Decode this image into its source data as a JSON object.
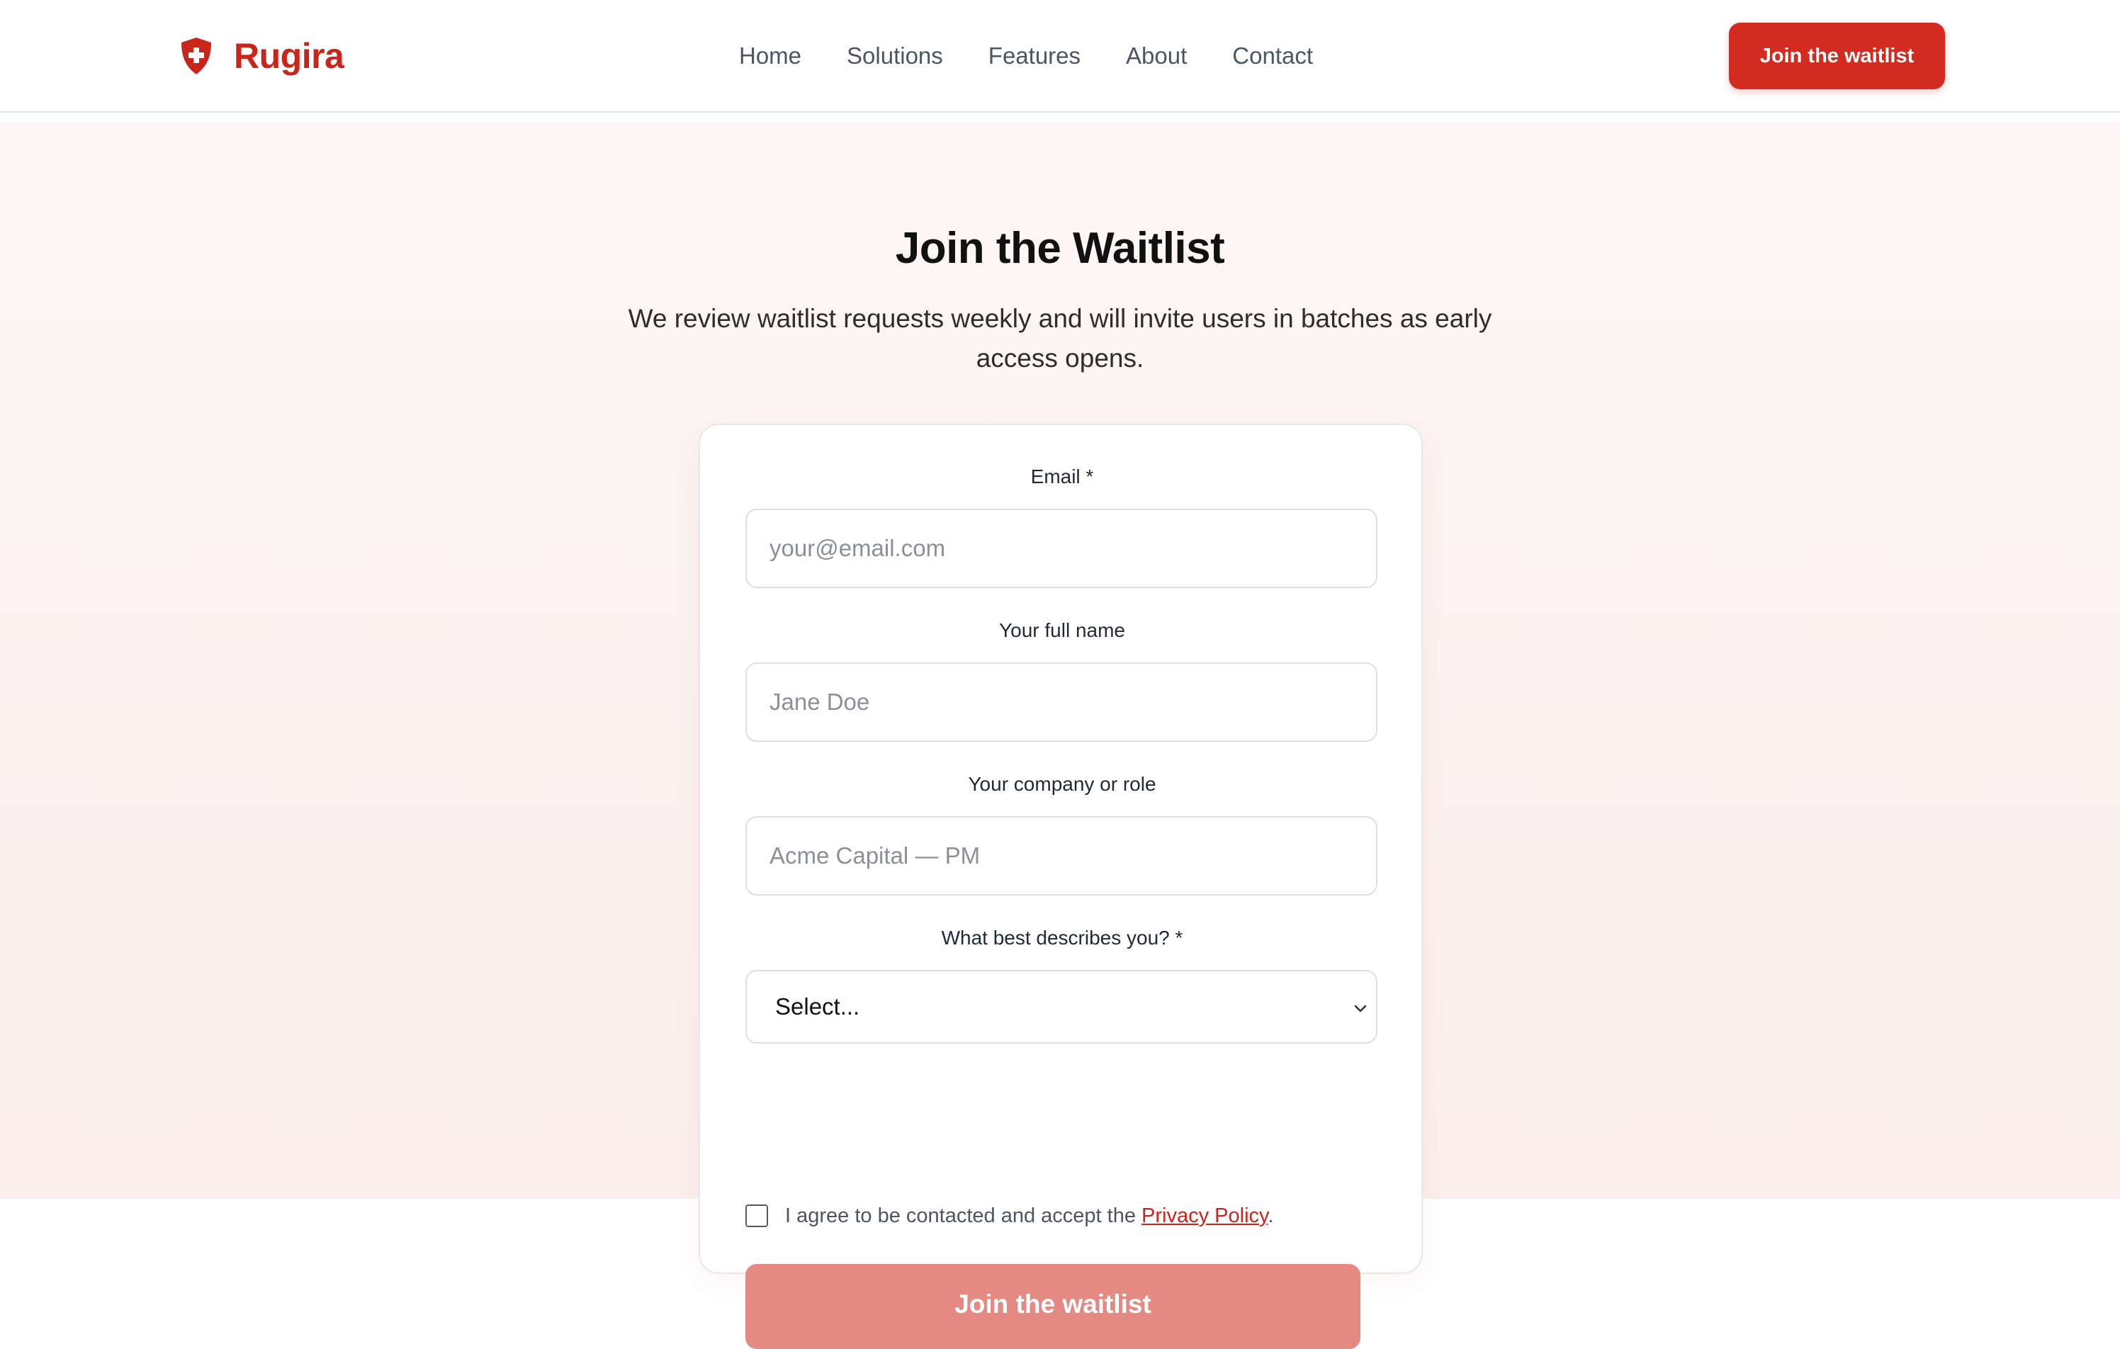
{
  "header": {
    "brand_name": "Rugira",
    "brand_icon": "shield-plus-icon",
    "nav": [
      "Home",
      "Solutions",
      "Features",
      "About",
      "Contact"
    ],
    "cta_label": "Join the waitlist",
    "accent_color": "#d22b1f"
  },
  "main": {
    "title": "Join the Waitlist",
    "subtitle": "We review waitlist requests weekly and will invite users in batches as early access opens."
  },
  "form": {
    "email": {
      "label": "Email *",
      "placeholder": "your@email.com",
      "value": ""
    },
    "name": {
      "label": "Your full name",
      "placeholder": "Jane Doe",
      "value": ""
    },
    "company": {
      "label": "Your company or role",
      "placeholder": "Acme Capital — PM",
      "value": ""
    },
    "role_type": {
      "label": "What best describes you? *",
      "selected": "Select..."
    },
    "consent": {
      "text": "I agree to be contacted and accept the",
      "link": "Privacy Policy",
      "suffix": ".",
      "checked": false
    },
    "submit_label": "Join the waitlist",
    "submit_color": "#e58a82"
  }
}
